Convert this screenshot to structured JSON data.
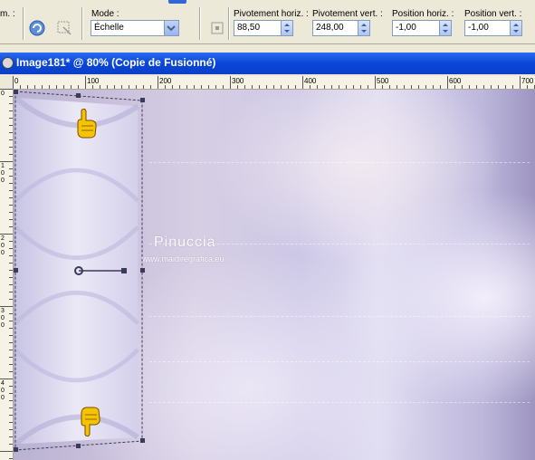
{
  "toolbar": {
    "partial_label": "m. :",
    "mode_label": "Mode :",
    "mode_value": "Échelle",
    "pivot_h_label": "Pivotement horiz. :",
    "pivot_h_value": "88,50",
    "pivot_v_label": "Pivotement vert. :",
    "pivot_v_value": "248,00",
    "pos_h_label": "Position horiz. :",
    "pos_h_value": "-1,00",
    "pos_v_label": "Position vert. :",
    "pos_v_value": "-1,00"
  },
  "window": {
    "title": "Image181* @  80% (Copie de Fusionné)"
  },
  "ruler_h": [
    "0",
    "100",
    "200",
    "300",
    "400",
    "500",
    "600",
    "700"
  ],
  "ruler_v": [
    "0",
    "1\n0\n0",
    "2\n0\n0",
    "3\n0\n0",
    "4\n0\n0"
  ],
  "watermark": {
    "name": "Pinuccia",
    "site": "www.maidiregrafica.eu"
  },
  "colors": {
    "title_bar": "#0a46d6",
    "handle": "#3a3a5a",
    "hand_icon": "#f5c400"
  },
  "icons": [
    "refresh-icon",
    "deform-icon",
    "pick-icon",
    "pointing-hand-icon"
  ]
}
